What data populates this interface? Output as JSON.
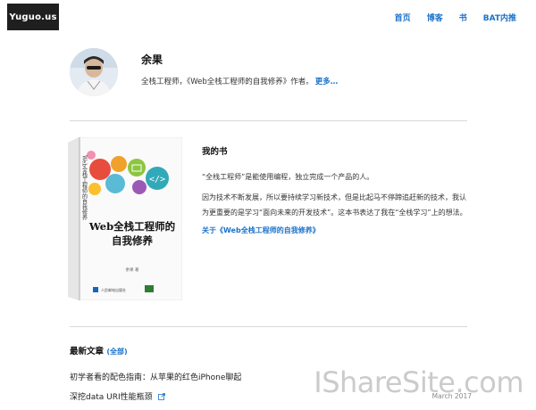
{
  "header": {
    "logo": "Yuguo.us",
    "nav": [
      {
        "label": "首页"
      },
      {
        "label": "博客"
      },
      {
        "label": "书"
      },
      {
        "label": "BAT内推"
      }
    ]
  },
  "profile": {
    "name": "余果",
    "description": "全栈工程师，《Web全栈工程师的自我修养》作者。",
    "more_link": "更多…"
  },
  "book": {
    "section_title": "我的书",
    "cover_title_line1": "Web全栈工程师的",
    "cover_title_line2": "自我修养",
    "cover_spine_text": "Web全栈工程师的自我修养",
    "cover_author": "余果 著",
    "cover_publisher": "人民邮电出版社",
    "paragraph1": "“全栈工程师”是能使用编程，独立完成一个产品的人。",
    "paragraph2": "因为技术不断发展，所以要持续学习新技术，但是比起马不停蹄追赶新的技术，我认为更重要的是学习“面向未来的开发技术”。这本书表达了我在“全栈学习”上的想法。",
    "link": "关于《Web全栈工程师的自我修养》"
  },
  "articles": {
    "heading": "最新文章",
    "all_link": "全部",
    "items": [
      {
        "title": "初学者看的配色指南：从苹果的红色iPhone聊起",
        "date": ""
      },
      {
        "title": "深挖data URI性能瓶颈",
        "date": "March 2017"
      }
    ]
  },
  "watermark": "IShareSite.com",
  "colors": {
    "link": "#1b72c9",
    "logo_bg": "#1f1f1f",
    "divider": "#d8d8d8"
  }
}
